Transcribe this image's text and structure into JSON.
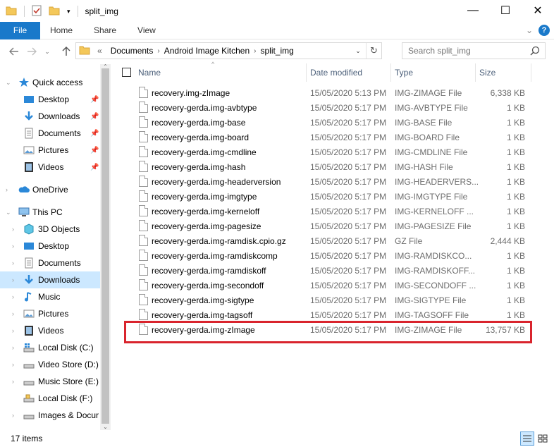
{
  "window": {
    "title": "split_img",
    "minimize_glyph": "—",
    "maximize_glyph": "☐",
    "close_glyph": "✕"
  },
  "ribbon": {
    "tabs": [
      "File",
      "Home",
      "Share",
      "View"
    ],
    "expand_glyph": "⌄",
    "help_glyph": "?"
  },
  "address": {
    "overflow": "«",
    "crumbs": [
      "Documents",
      "Android Image Kitchen",
      "split_img"
    ],
    "separator": "›"
  },
  "search": {
    "placeholder": "Search split_img"
  },
  "nav": {
    "quick_access": "Quick access",
    "quick_items": [
      "Desktop",
      "Downloads",
      "Documents",
      "Pictures",
      "Videos"
    ],
    "onedrive": "OneDrive",
    "this_pc": "This PC",
    "pc_items": [
      "3D Objects",
      "Desktop",
      "Documents",
      "Downloads",
      "Music",
      "Pictures",
      "Videos",
      "Local Disk (C:)",
      "Video Store (D:)",
      "Music Store (E:)",
      "Local Disk (F:)",
      "Images & Docur"
    ]
  },
  "columns": {
    "name": "Name",
    "date": "Date modified",
    "type": "Type",
    "size": "Size"
  },
  "files": [
    {
      "name": "recovery.img-zImage",
      "date": "15/05/2020 5:13 PM",
      "type": "IMG-ZIMAGE File",
      "size": "6,338 KB"
    },
    {
      "name": "recovery-gerda.img-avbtype",
      "date": "15/05/2020 5:17 PM",
      "type": "IMG-AVBTYPE File",
      "size": "1 KB"
    },
    {
      "name": "recovery-gerda.img-base",
      "date": "15/05/2020 5:17 PM",
      "type": "IMG-BASE File",
      "size": "1 KB"
    },
    {
      "name": "recovery-gerda.img-board",
      "date": "15/05/2020 5:17 PM",
      "type": "IMG-BOARD File",
      "size": "1 KB"
    },
    {
      "name": "recovery-gerda.img-cmdline",
      "date": "15/05/2020 5:17 PM",
      "type": "IMG-CMDLINE File",
      "size": "1 KB"
    },
    {
      "name": "recovery-gerda.img-hash",
      "date": "15/05/2020 5:17 PM",
      "type": "IMG-HASH File",
      "size": "1 KB"
    },
    {
      "name": "recovery-gerda.img-headerversion",
      "date": "15/05/2020 5:17 PM",
      "type": "IMG-HEADERVERS...",
      "size": "1 KB"
    },
    {
      "name": "recovery-gerda.img-imgtype",
      "date": "15/05/2020 5:17 PM",
      "type": "IMG-IMGTYPE File",
      "size": "1 KB"
    },
    {
      "name": "recovery-gerda.img-kerneloff",
      "date": "15/05/2020 5:17 PM",
      "type": "IMG-KERNELOFF ...",
      "size": "1 KB"
    },
    {
      "name": "recovery-gerda.img-pagesize",
      "date": "15/05/2020 5:17 PM",
      "type": "IMG-PAGESIZE File",
      "size": "1 KB"
    },
    {
      "name": "recovery-gerda.img-ramdisk.cpio.gz",
      "date": "15/05/2020 5:17 PM",
      "type": "GZ File",
      "size": "2,444 KB"
    },
    {
      "name": "recovery-gerda.img-ramdiskcomp",
      "date": "15/05/2020 5:17 PM",
      "type": "IMG-RAMDISKCO...",
      "size": "1 KB"
    },
    {
      "name": "recovery-gerda.img-ramdiskoff",
      "date": "15/05/2020 5:17 PM",
      "type": "IMG-RAMDISKOFF...",
      "size": "1 KB"
    },
    {
      "name": "recovery-gerda.img-secondoff",
      "date": "15/05/2020 5:17 PM",
      "type": "IMG-SECONDOFF ...",
      "size": "1 KB"
    },
    {
      "name": "recovery-gerda.img-sigtype",
      "date": "15/05/2020 5:17 PM",
      "type": "IMG-SIGTYPE File",
      "size": "1 KB"
    },
    {
      "name": "recovery-gerda.img-tagsoff",
      "date": "15/05/2020 5:17 PM",
      "type": "IMG-TAGSOFF File",
      "size": "1 KB"
    },
    {
      "name": "recovery-gerda.img-zImage",
      "date": "15/05/2020 5:17 PM",
      "type": "IMG-ZIMAGE File",
      "size": "13,757 KB"
    }
  ],
  "status": {
    "count": "17 items"
  },
  "colors": {
    "accent": "#1979ca",
    "selection": "#cce8ff",
    "highlight_box": "#d9242d"
  }
}
